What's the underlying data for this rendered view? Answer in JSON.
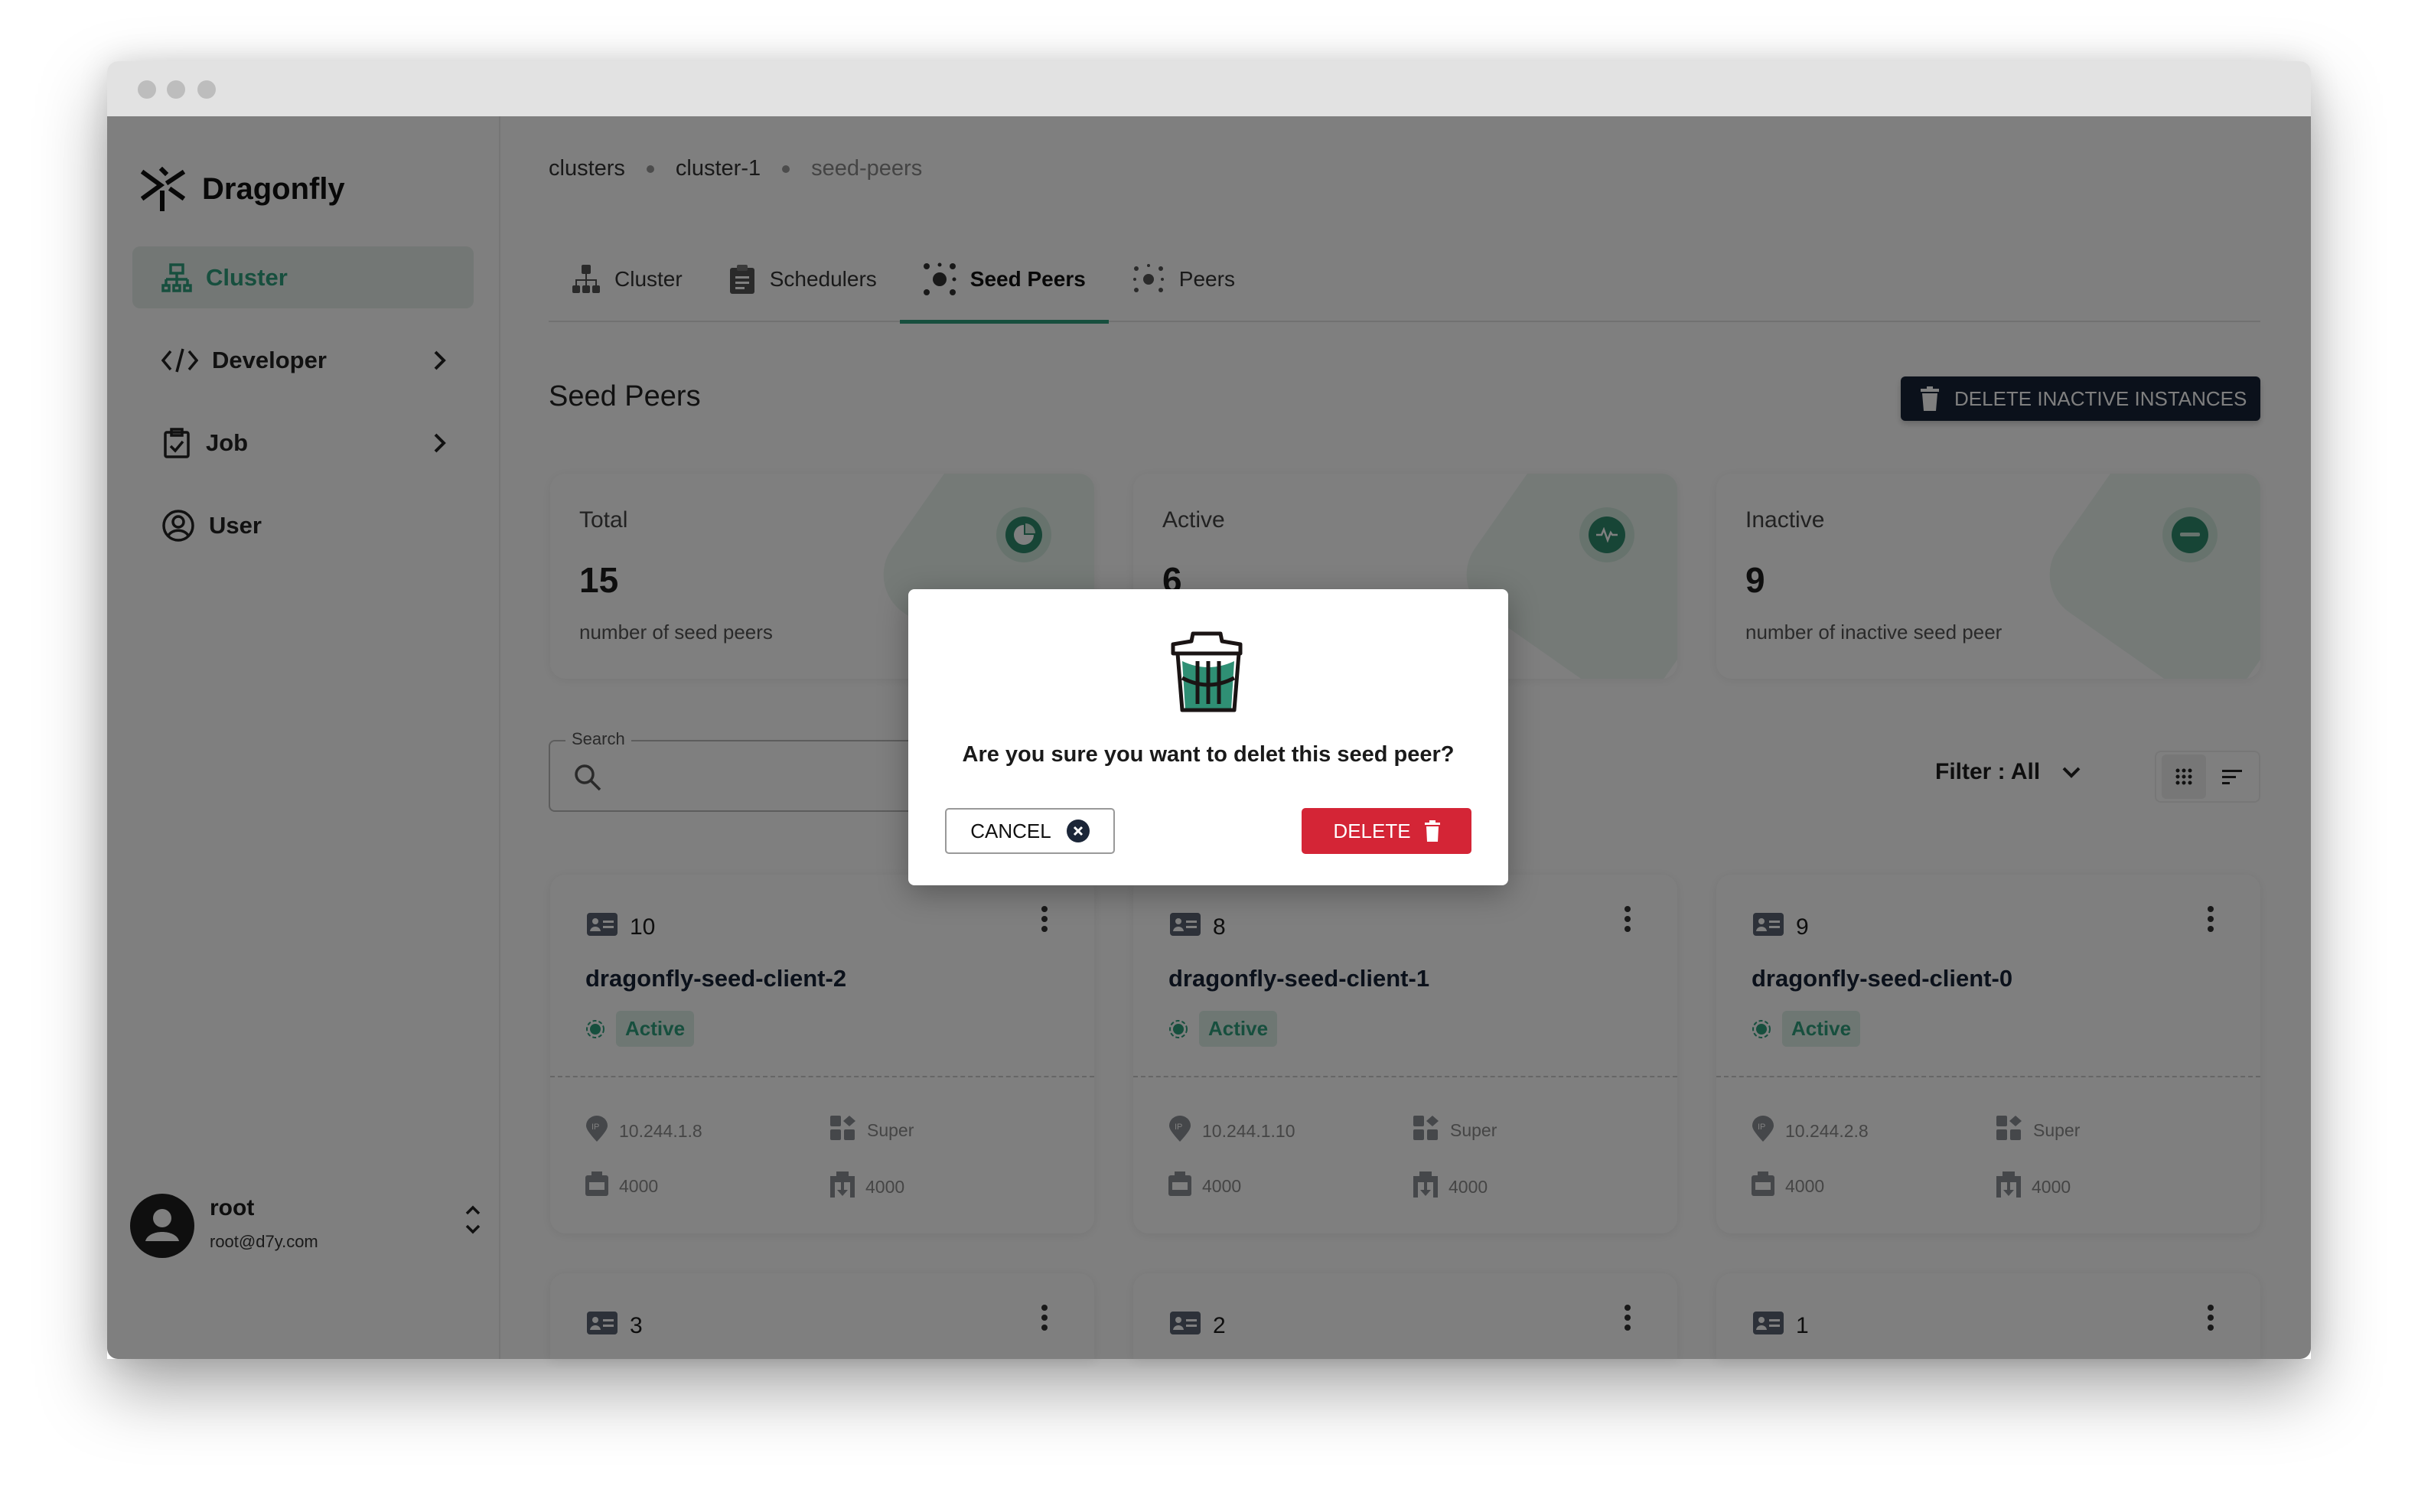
{
  "colors": {
    "accent": "#2f9e7c",
    "danger": "#d42536",
    "dark_button": "#172336"
  },
  "sidebar": {
    "brand": "Dragonfly",
    "items": [
      {
        "label": "Cluster",
        "icon": "cluster-icon",
        "active": true
      },
      {
        "label": "Developer",
        "icon": "code-icon",
        "expandable": true
      },
      {
        "label": "Job",
        "icon": "clipboard-icon",
        "expandable": true
      },
      {
        "label": "User",
        "icon": "user-circle-icon"
      }
    ],
    "user": {
      "name": "root",
      "email": "root@d7y.com"
    }
  },
  "breadcrumb": [
    "clusters",
    "cluster-1",
    "seed-peers"
  ],
  "tabs": [
    {
      "label": "Cluster",
      "icon": "cluster-icon"
    },
    {
      "label": "Schedulers",
      "icon": "clipboard-icon"
    },
    {
      "label": "Seed Peers",
      "icon": "seed-peers-icon",
      "active": true
    },
    {
      "label": "Peers",
      "icon": "peers-icon"
    }
  ],
  "page": {
    "title": "Seed Peers",
    "delete_inactive_label": "DELETE INACTIVE INSTANCES"
  },
  "stats": [
    {
      "label": "Total",
      "value": "15",
      "desc": "number of seed peers",
      "icon": "pie-chart-icon"
    },
    {
      "label": "Active",
      "value": "6",
      "icon": "activity-icon"
    },
    {
      "label": "Inactive",
      "value": "9",
      "desc": "number of inactive seed peer",
      "icon": "minus-circle-icon"
    }
  ],
  "search": {
    "label": "Search",
    "value": ""
  },
  "filter": {
    "label": "Filter : All"
  },
  "peers": [
    {
      "id": "10",
      "name": "dragonfly-seed-client-2",
      "status": "Active",
      "ip": "10.244.1.8",
      "type": "Super",
      "port": "4000",
      "download_port": "4000"
    },
    {
      "id": "8",
      "name": "dragonfly-seed-client-1",
      "status": "Active",
      "ip": "10.244.1.10",
      "type": "Super",
      "port": "4000",
      "download_port": "4000"
    },
    {
      "id": "9",
      "name": "dragonfly-seed-client-0",
      "status": "Active",
      "ip": "10.244.2.8",
      "type": "Super",
      "port": "4000",
      "download_port": "4000"
    },
    {
      "id": "3"
    },
    {
      "id": "2"
    },
    {
      "id": "1"
    }
  ],
  "modal": {
    "message": "Are you sure you want to delet this seed peer?",
    "cancel_label": "CANCEL",
    "delete_label": "DELETE"
  }
}
